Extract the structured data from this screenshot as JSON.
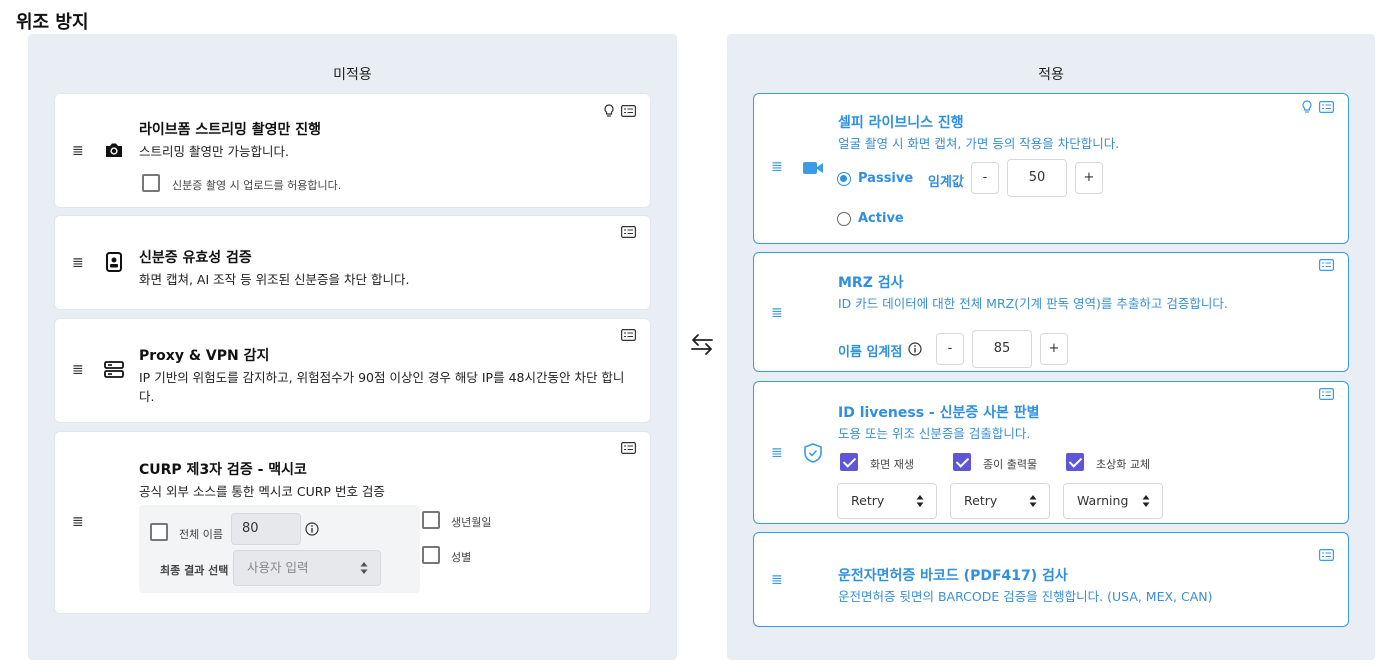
{
  "page": {
    "title": "위조 방지"
  },
  "left_panel": {
    "title": "미적용",
    "cards": {
      "live": {
        "title": "라이브폼 스트리밍 촬영만 진행",
        "desc": "스트리밍 촬영만 가능합니다.",
        "checkbox_label": "신분증 촬영 시 업로드를 허용합니다."
      },
      "id_valid": {
        "title": "신분증 유효성 검증",
        "desc": "화면 캡쳐, AI 조작 등 위조된 신분증을 차단 합니다."
      },
      "proxy": {
        "title": "Proxy & VPN 감지",
        "desc": "IP 기반의 위험도를 감지하고, 위험점수가 90점 이상인 경우 해당 IP를 48시간동안 차단 합니다."
      },
      "curp": {
        "title": "CURP 제3자 검증 - 맥시코",
        "desc": "공식 외부 소스를 통한 멕시코 CURP 번호 검증",
        "full_name_label": "전체 이름",
        "full_name_value": "80",
        "birth_label": "생년월일",
        "gender_label": "성별",
        "final_label": "최종 결과 선택",
        "final_select": "사용자 입력"
      }
    }
  },
  "right_panel": {
    "title": "적용",
    "cards": {
      "selfie": {
        "title": "셀피 라이브니스 진행",
        "desc": "얼굴 촬영 시 화면 캡쳐, 가면 등의 작용을 차단합니다.",
        "passive_label": "Passive",
        "threshold_label": "임계값",
        "threshold_value": "50",
        "active_label": "Active",
        "minus": "-",
        "plus": "+"
      },
      "mrz": {
        "title": "MRZ 검사",
        "desc": "ID 카드 데이터에 대한 전체 MRZ(기계 판독 영역)를 추출하고 검증합니다.",
        "name_threshold_label": "이름 임계점",
        "name_threshold_value": "85",
        "minus": "-",
        "plus": "+"
      },
      "idliveness": {
        "title": "ID liveness - 신분증 사본 판별",
        "desc": "도용 또는 위조 신분증을 검출합니다.",
        "options": [
          {
            "label": "화면 재생",
            "select": "Retry"
          },
          {
            "label": "종이 출력물",
            "select": "Retry"
          },
          {
            "label": "초상화 교체",
            "select": "Warning"
          }
        ]
      },
      "barcode": {
        "title": "운전자면허증 바코드 (PDF417) 검사",
        "desc": "운전면허증 뒷면의 BARCODE 검증을 진행합니다. (USA, MEX, CAN)"
      }
    }
  },
  "colors": {
    "accent": "#2f8fe0",
    "panel_bg": "#e9eef4",
    "checkbox_checked": "#5e56d6"
  }
}
